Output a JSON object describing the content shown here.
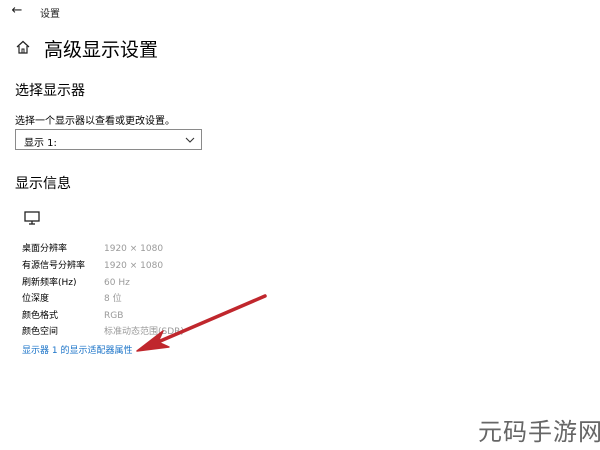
{
  "window": {
    "back_icon": "back-arrow-icon",
    "app_title": "设置"
  },
  "page": {
    "home_icon": "home-icon",
    "title": "高级显示设置"
  },
  "display_select": {
    "heading": "选择显示器",
    "helper": "选择一个显示器以查看或更改设置。",
    "selected": "显示 1:",
    "chevron_icon": "chevron-down-icon"
  },
  "display_info": {
    "heading": "显示信息",
    "monitor_icon": "monitor-icon",
    "rows": [
      {
        "label": "桌面分辨率",
        "value": "1920 × 1080"
      },
      {
        "label": "有源信号分辨率",
        "value": "1920 × 1080"
      },
      {
        "label": "刷新频率(Hz)",
        "value": "60 Hz"
      },
      {
        "label": "位深度",
        "value": "8 位"
      },
      {
        "label": "颜色格式",
        "value": "RGB"
      },
      {
        "label": "颜色空间",
        "value": "标准动态范围(SDR)"
      }
    ],
    "adapter_link": "显示器 1 的显示适配器属性"
  },
  "annotation": {
    "arrow_color": "#c0272d"
  },
  "watermark": {
    "text": "元码手游网"
  },
  "colors": {
    "link": "#1a73c8",
    "value_text": "#9a9a9a"
  }
}
